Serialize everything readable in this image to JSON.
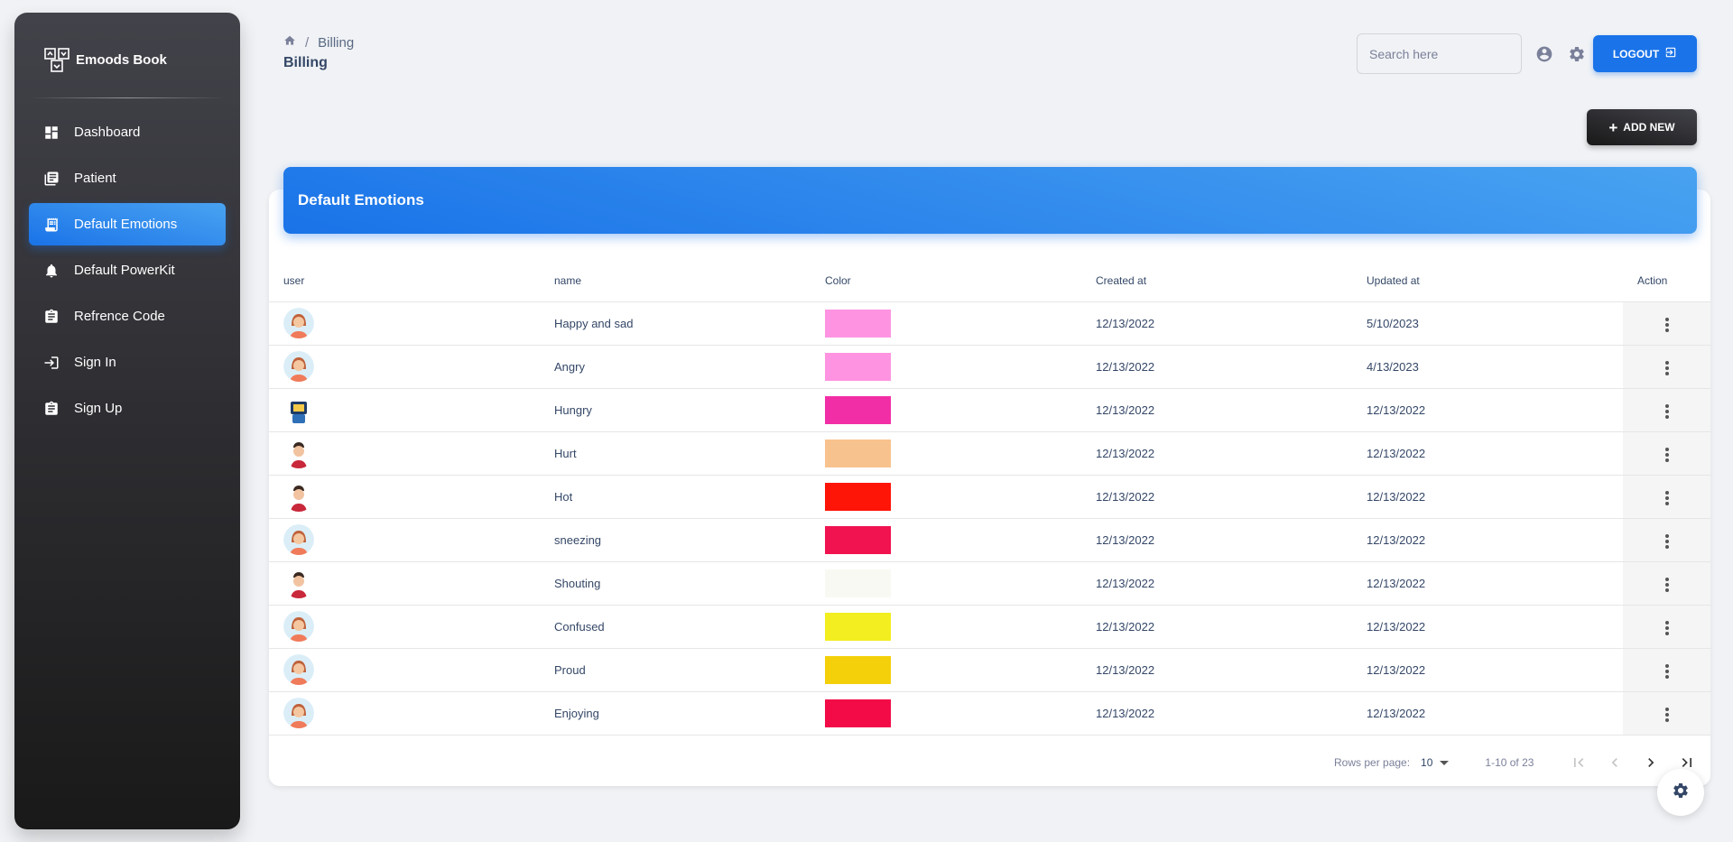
{
  "brand": {
    "name": "Emoods Book"
  },
  "sidebar": {
    "items": [
      {
        "label": "Dashboard",
        "icon": "dashboard-icon",
        "active": false
      },
      {
        "label": "Patient",
        "icon": "library-icon",
        "active": false
      },
      {
        "label": "Default Emotions",
        "icon": "receipt-icon",
        "active": true
      },
      {
        "label": "Default PowerKit",
        "icon": "bell-icon",
        "active": false
      },
      {
        "label": "Refrence Code",
        "icon": "assignment-icon",
        "active": false
      },
      {
        "label": "Sign In",
        "icon": "login-icon",
        "active": false
      },
      {
        "label": "Sign Up",
        "icon": "assignment-icon",
        "active": false
      }
    ]
  },
  "header": {
    "breadcrumb": "Billing",
    "title": "Billing",
    "search_placeholder": "Search here",
    "logout_label": "LOGOUT"
  },
  "toolbar": {
    "add_new_label": "ADD NEW"
  },
  "table": {
    "title": "Default Emotions",
    "columns": [
      "user",
      "name",
      "Color",
      "Created at",
      "Updated at",
      "Action"
    ],
    "rows": [
      {
        "avatar": "woman-avatar",
        "name": "Happy and sad",
        "color": "#fe94e1",
        "created": "12/13/2022",
        "updated": "5/10/2023"
      },
      {
        "avatar": "woman-avatar",
        "name": "Angry",
        "color": "#fe94e1",
        "created": "12/13/2022",
        "updated": "4/13/2023"
      },
      {
        "avatar": "robot-avatar",
        "name": "Hungry",
        "color": "#f22ea6",
        "created": "12/13/2022",
        "updated": "12/13/2022"
      },
      {
        "avatar": "man-avatar",
        "name": "Hurt",
        "color": "#f8c28f",
        "created": "12/13/2022",
        "updated": "12/13/2022"
      },
      {
        "avatar": "man-avatar",
        "name": "Hot",
        "color": "#ff1408",
        "created": "12/13/2022",
        "updated": "12/13/2022"
      },
      {
        "avatar": "woman-avatar",
        "name": "sneezing",
        "color": "#f0134f",
        "created": "12/13/2022",
        "updated": "12/13/2022"
      },
      {
        "avatar": "man-avatar",
        "name": "Shouting",
        "color": "#f8f9f2",
        "created": "12/13/2022",
        "updated": "12/13/2022"
      },
      {
        "avatar": "woman-avatar",
        "name": "Confused",
        "color": "#f2ee1f",
        "created": "12/13/2022",
        "updated": "12/13/2022"
      },
      {
        "avatar": "woman-avatar",
        "name": "Proud",
        "color": "#f4d00b",
        "created": "12/13/2022",
        "updated": "12/13/2022"
      },
      {
        "avatar": "woman-avatar",
        "name": "Enjoying",
        "color": "#f20b47",
        "created": "12/13/2022",
        "updated": "12/13/2022"
      }
    ]
  },
  "pagination": {
    "rows_per_page_label": "Rows per page:",
    "rows_per_page": "10",
    "range": "1-10 of 23"
  },
  "colors": {
    "accent": "#1A73E8",
    "sidebar_dark": "#191919"
  }
}
